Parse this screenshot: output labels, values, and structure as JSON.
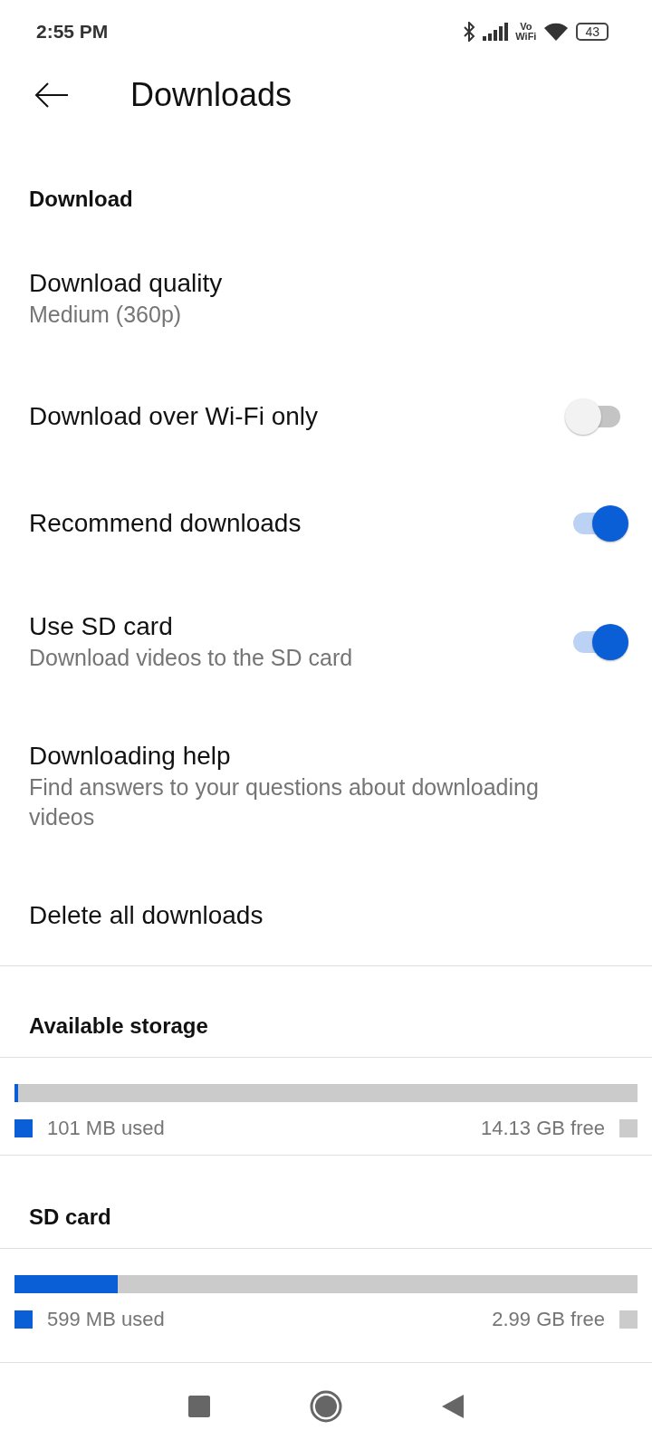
{
  "status_bar": {
    "time": "2:55 PM",
    "vowifi_top": "Vo",
    "vowifi_bottom": "WiFi",
    "battery": "43"
  },
  "app_bar": {
    "title": "Downloads"
  },
  "section": {
    "title": "Download"
  },
  "settings": [
    {
      "kind": "nav",
      "title": "Download quality",
      "subtitle": "Medium (360p)"
    },
    {
      "kind": "toggle",
      "title": "Download over Wi-Fi only",
      "on": false
    },
    {
      "kind": "toggle",
      "title": "Recommend downloads",
      "on": true
    },
    {
      "kind": "toggle",
      "title": "Use SD card",
      "subtitle": "Download videos to the SD card",
      "on": true
    },
    {
      "kind": "nav",
      "title": "Downloading help",
      "subtitle": "Find answers to your questions about downloading videos"
    },
    {
      "kind": "nav",
      "title": "Delete all downloads"
    }
  ],
  "storage": [
    {
      "title": "Available storage",
      "level": 0.006,
      "used": "101 MB used",
      "free": "14.13 GB free"
    },
    {
      "title": "SD card",
      "level": 0.165,
      "used": "599 MB used",
      "free": "2.99 GB free"
    }
  ]
}
